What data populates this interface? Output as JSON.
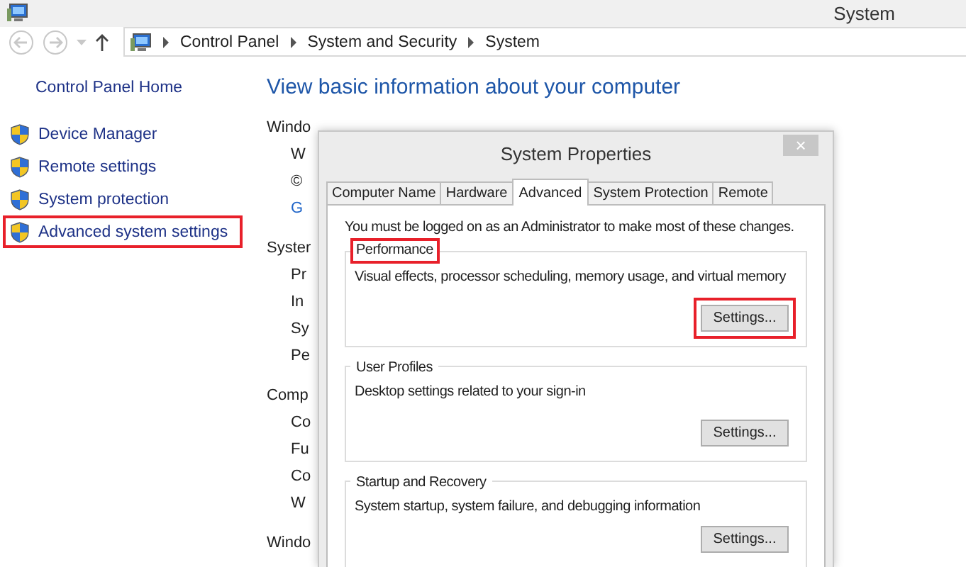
{
  "window": {
    "title": "System"
  },
  "address_bar": {
    "breadcrumbs": [
      "Control Panel",
      "System and Security",
      "System"
    ]
  },
  "sidebar": {
    "home_link": "Control Panel Home",
    "items": [
      {
        "label": "Device Manager",
        "highlighted": false
      },
      {
        "label": "Remote settings",
        "highlighted": false
      },
      {
        "label": "System protection",
        "highlighted": false
      },
      {
        "label": "Advanced system settings",
        "highlighted": true
      }
    ]
  },
  "main": {
    "heading": "View basic information about your computer",
    "sections": [
      {
        "title": "Windo",
        "items": [
          {
            "text": "W",
            "kind": "text"
          },
          {
            "text": "©",
            "kind": "text"
          },
          {
            "text": "G",
            "kind": "link"
          }
        ]
      },
      {
        "title": "Syster",
        "items": [
          {
            "text": "Pr",
            "kind": "text"
          },
          {
            "text": "In",
            "kind": "text"
          },
          {
            "text": "Sy",
            "kind": "text"
          },
          {
            "text": "Pe",
            "kind": "text"
          }
        ]
      },
      {
        "title": "Comp",
        "items": [
          {
            "text": "Co",
            "kind": "text"
          },
          {
            "text": "Fu",
            "kind": "text"
          },
          {
            "text": "Co",
            "kind": "text"
          },
          {
            "text": "W",
            "kind": "text"
          }
        ]
      },
      {
        "title": "Windo"
      }
    ]
  },
  "dialog": {
    "title": "System Properties",
    "close_label": "×",
    "tabs": [
      {
        "label": "Computer Name",
        "selected": false
      },
      {
        "label": "Hardware",
        "selected": false
      },
      {
        "label": "Advanced",
        "selected": true
      },
      {
        "label": "System Protection",
        "selected": false
      },
      {
        "label": "Remote",
        "selected": false
      }
    ],
    "notice": "You must be logged on as an Administrator to make most of these changes.",
    "groups": [
      {
        "title": "Performance",
        "title_highlighted": true,
        "description": "Visual effects, processor scheduling, memory usage, and virtual memory",
        "button": {
          "label": "Settings...",
          "highlighted": true
        }
      },
      {
        "title": "User Profiles",
        "title_highlighted": false,
        "description": "Desktop settings related to your sign-in",
        "button": {
          "label": "Settings...",
          "highlighted": false
        }
      },
      {
        "title": "Startup and Recovery",
        "title_highlighted": false,
        "description": "System startup, system failure, and debugging information",
        "button": {
          "label": "Settings...",
          "highlighted": false
        }
      }
    ]
  }
}
